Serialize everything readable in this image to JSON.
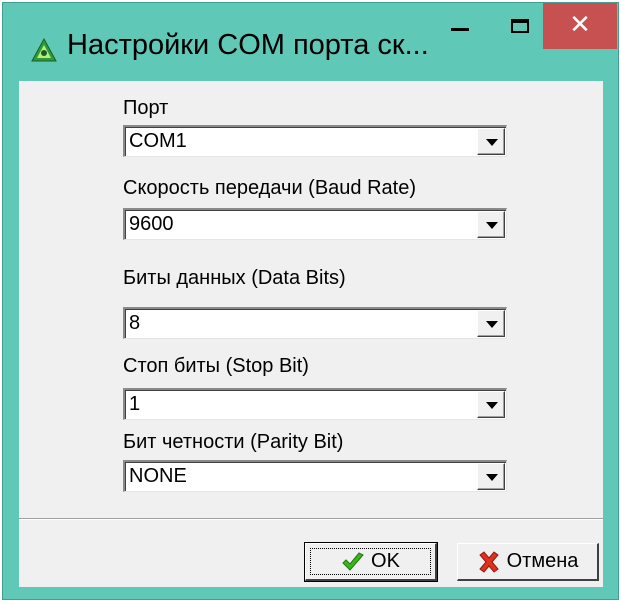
{
  "window": {
    "title": "Настройки COM порта ск..."
  },
  "fields": [
    {
      "label": "Порт",
      "value": "COM1"
    },
    {
      "label": "Скорость передачи (Baud Rate)",
      "value": "9600"
    },
    {
      "label": "Биты данных (Data Bits)",
      "value": "8"
    },
    {
      "label": "Стоп биты (Stop Bit)",
      "value": "1"
    },
    {
      "label": "Бит четности (Parity Bit)",
      "value": "NONE"
    }
  ],
  "buttons": {
    "ok_label": "OK",
    "cancel_label": "Отмена"
  },
  "colors": {
    "titlebar": "#5fc8b7",
    "close_button": "#c75050",
    "dialog_face": "#f0f0f0",
    "ok_icon": "#3cb41e",
    "cancel_icon": "#e0301e"
  },
  "icons": {
    "app": "triangle-logo-icon",
    "ok": "checkmark-icon",
    "cancel": "red-x-icon"
  }
}
